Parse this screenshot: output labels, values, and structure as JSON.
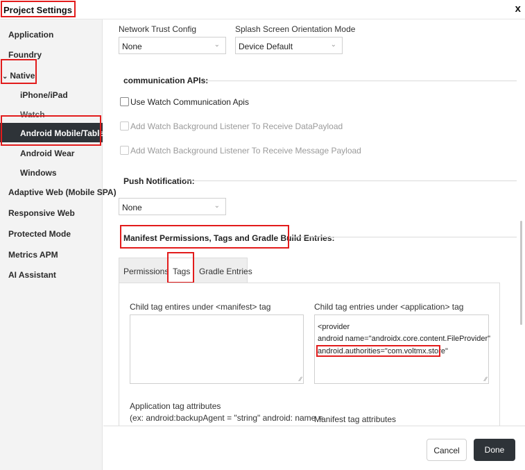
{
  "window": {
    "title": "Project Settings",
    "close_glyph": "x"
  },
  "sidebar": {
    "items": [
      {
        "label": "Application"
      },
      {
        "label": "Foundry"
      },
      {
        "label": "Native",
        "expanded": true
      },
      {
        "label": "iPhone/iPad"
      },
      {
        "label": "Watch"
      },
      {
        "label": "Android Mobile/Tablet",
        "selected": true
      },
      {
        "label": "Android Wear"
      },
      {
        "label": "Windows"
      },
      {
        "label": "Adaptive Web (Mobile SPA)"
      },
      {
        "label": "Responsive Web"
      },
      {
        "label": "Protected Mode"
      },
      {
        "label": "Metrics APM"
      },
      {
        "label": "AI Assistant"
      }
    ]
  },
  "main": {
    "network_trust": {
      "label": "Network Trust Config",
      "value": "None"
    },
    "splash_orientation": {
      "label": "Splash Screen Orientation Mode",
      "value": "Device Default"
    },
    "communication_apis": {
      "heading": "communication APIs:",
      "options": [
        {
          "label": "Use Watch Communication Apis",
          "checked": false,
          "disabled": false
        },
        {
          "label": "Add Watch Background Listener To Receive DataPayload",
          "checked": false,
          "disabled": true
        },
        {
          "label": "Add Watch Background Listener To Receive Message Payload",
          "checked": false,
          "disabled": true
        }
      ]
    },
    "push_notification": {
      "heading": "Push Notification:",
      "value": "None"
    },
    "manifest": {
      "heading": "Manifest Permissions, Tags and Gradle Build Entries:",
      "tabs": [
        {
          "label": "Permissions"
        },
        {
          "label": "Tags",
          "active": true
        },
        {
          "label": "Gradle Entries"
        }
      ],
      "child_manifest": {
        "label": "Child tag entires under <manifest> tag",
        "value": ""
      },
      "child_application": {
        "label": "Child tag entries under <application> tag",
        "lines": [
          "<provider",
          "android name=\"androidx.core.content.FileProvider\"",
          "android.authorities=\"com.voltmx.store\""
        ]
      },
      "app_tag_attributes": {
        "label": "Application tag attributes",
        "hint": "(ex: android:backupAgent = \"string\" android: name ="
      },
      "manifest_tag_attributes": {
        "label": "Manifest tag attributes"
      }
    }
  },
  "footer": {
    "cancel_label": "Cancel",
    "done_label": "Done"
  },
  "colors": {
    "highlight": "#e21b1b",
    "selected_bg": "#2e3338",
    "sidebar_bg": "#f3f3f3"
  }
}
